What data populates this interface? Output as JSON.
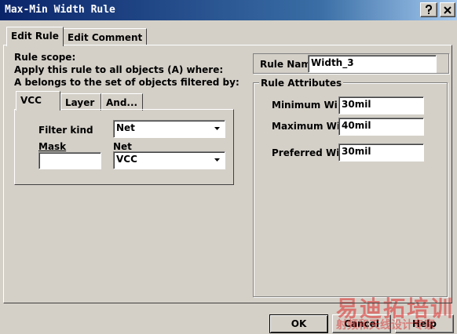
{
  "window": {
    "title": "Max-Min Width Rule"
  },
  "tabs": [
    {
      "label": "Edit Rule",
      "active": true
    },
    {
      "label": "Edit Comment",
      "active": false
    }
  ],
  "scope": {
    "heading": "Rule scope:",
    "line1": "Apply this rule to all objects (A) where:",
    "line2": "A belongs to the set of objects filtered by:",
    "inner_tabs": [
      {
        "label": "VCC",
        "active": true
      },
      {
        "label": "Layer"
      },
      {
        "label": "And..."
      }
    ],
    "filter_kind_label": "Filter kind",
    "filter_kind_value": "Net",
    "mask_label": "Mask",
    "mask_value": "",
    "net_label": "Net",
    "net_value": "VCC"
  },
  "rule_name": {
    "label": "Rule Nam",
    "value": "Width_3"
  },
  "attributes": {
    "title": "Rule Attributes",
    "minimum": {
      "label": "Minimum Wi",
      "value": "30mil"
    },
    "maximum": {
      "label": "Maximum Wi",
      "value": "40mil"
    },
    "preferred": {
      "label": "Preferred Wi",
      "value": "30mil"
    }
  },
  "buttons": {
    "ok": "OK",
    "cancel": "Cancel",
    "help": "Help"
  },
  "watermark": {
    "main": "易迪拓培训",
    "sub": "射频和天线设计专家"
  },
  "colors": {
    "titlebar_start": "#0a246a",
    "titlebar_end": "#a6caf0",
    "dialog_bg": "#d4d0c8"
  },
  "icons": {
    "help_title": "question-icon",
    "close_title": "close-icon",
    "dropdown": "chevron-down-icon"
  }
}
